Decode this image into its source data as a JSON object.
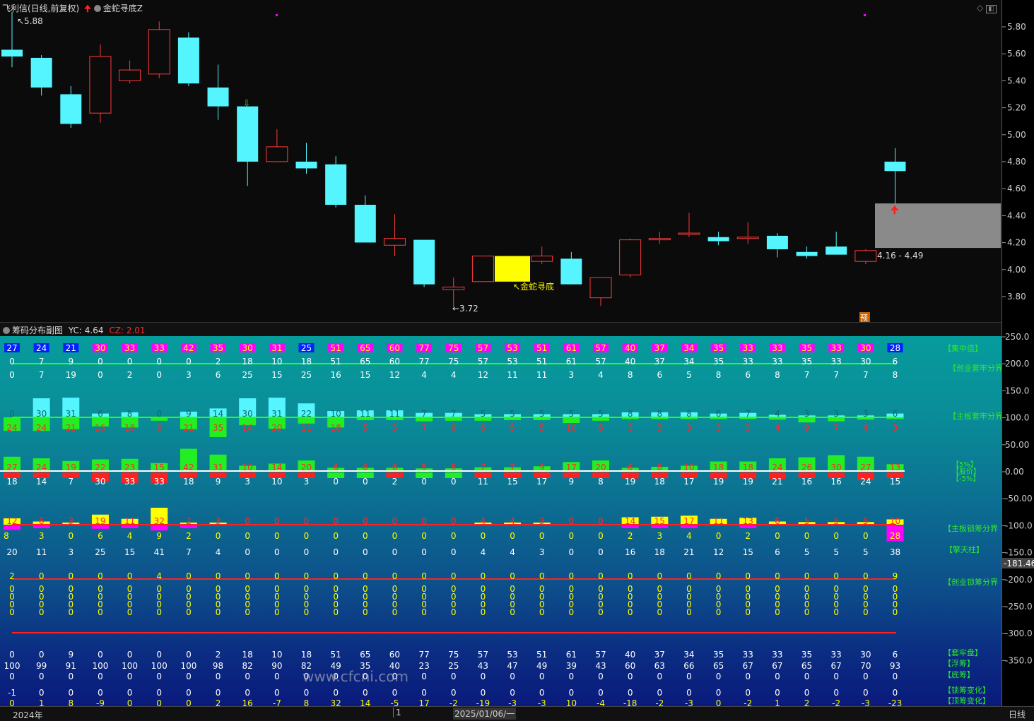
{
  "header": {
    "stock": "飞利信(日线,前复权)",
    "formula": "金蛇寻底Z",
    "sub_title": "筹码分布副图",
    "yc_label": "YC:",
    "yc_value": "4.64",
    "cz_label": "CZ:",
    "cz_value": "2.01"
  },
  "price_axis": [
    "5.80",
    "5.60",
    "5.40",
    "5.20",
    "5.00",
    "4.80",
    "4.60",
    "4.40",
    "4.20",
    "4.00",
    "3.80"
  ],
  "sub_axis": [
    "250.0",
    "200.0",
    "150.0",
    "100.0",
    "50.00",
    "0.00",
    "-50.00",
    "-100.0",
    "-150.0",
    "-200.0",
    "-250.0",
    "-300.0",
    "-350.0"
  ],
  "cursor_value": "-181.46",
  "annotations": {
    "high": "5.88",
    "low": "3.72",
    "range": "4.16 - 4.49",
    "signal_text": "金蛇寻底",
    "pre_badge": "预"
  },
  "colors": {
    "up": "#ff3b3b",
    "down": "#54f5ff",
    "yellow": "#ffff00",
    "green": "#22ee22",
    "magenta": "#ff00ff",
    "blue": "#0020ff"
  },
  "candles": [
    {
      "o": 5.58,
      "h": 5.91,
      "l": 5.5,
      "c": 5.63,
      "up": false
    },
    {
      "o": 5.57,
      "h": 5.59,
      "l": 5.29,
      "c": 5.35,
      "up": false
    },
    {
      "o": 5.3,
      "h": 5.36,
      "l": 5.05,
      "c": 5.08,
      "up": false
    },
    {
      "o": 5.16,
      "h": 5.67,
      "l": 5.09,
      "c": 5.58,
      "up": true
    },
    {
      "o": 5.4,
      "h": 5.55,
      "l": 5.38,
      "c": 5.48,
      "up": true
    },
    {
      "o": 5.45,
      "h": 5.84,
      "l": 5.42,
      "c": 5.78,
      "up": true
    },
    {
      "o": 5.72,
      "h": 5.76,
      "l": 5.36,
      "c": 5.38,
      "up": false
    },
    {
      "o": 5.35,
      "h": 5.52,
      "l": 5.11,
      "c": 5.21,
      "up": false
    },
    {
      "o": 5.21,
      "h": 5.21,
      "l": 4.62,
      "c": 4.8,
      "up": false
    },
    {
      "o": 4.8,
      "h": 5.04,
      "l": 4.8,
      "c": 4.91,
      "up": true
    },
    {
      "o": 4.8,
      "h": 4.94,
      "l": 4.71,
      "c": 4.75,
      "up": false
    },
    {
      "o": 4.78,
      "h": 4.84,
      "l": 4.46,
      "c": 4.48,
      "up": false
    },
    {
      "o": 4.48,
      "h": 4.55,
      "l": 4.2,
      "c": 4.2,
      "up": false
    },
    {
      "o": 4.18,
      "h": 4.41,
      "l": 4.1,
      "c": 4.23,
      "up": true
    },
    {
      "o": 4.22,
      "h": 4.22,
      "l": 3.87,
      "c": 3.89,
      "up": false
    },
    {
      "o": 3.85,
      "h": 3.94,
      "l": 3.72,
      "c": 3.87,
      "up": true
    },
    {
      "o": 3.91,
      "h": 4.1,
      "l": 3.91,
      "c": 4.1,
      "up": true
    },
    {
      "o": 4.1,
      "h": 4.1,
      "l": 3.91,
      "c": 3.92,
      "up": false
    },
    {
      "o": 4.06,
      "h": 4.17,
      "l": 4.04,
      "c": 4.1,
      "up": true
    },
    {
      "o": 4.08,
      "h": 4.13,
      "l": 3.89,
      "c": 3.89,
      "up": false
    },
    {
      "o": 3.79,
      "h": 3.94,
      "l": 3.73,
      "c": 3.94,
      "up": true
    },
    {
      "o": 3.96,
      "h": 4.23,
      "l": 3.94,
      "c": 4.22,
      "up": true
    },
    {
      "o": 4.22,
      "h": 4.28,
      "l": 4.19,
      "c": 4.23,
      "up": true
    },
    {
      "o": 4.26,
      "h": 4.42,
      "l": 4.24,
      "c": 4.27,
      "up": true
    },
    {
      "o": 4.24,
      "h": 4.28,
      "l": 4.18,
      "c": 4.21,
      "up": false
    },
    {
      "o": 4.23,
      "h": 4.35,
      "l": 4.19,
      "c": 4.24,
      "up": true
    },
    {
      "o": 4.25,
      "h": 4.27,
      "l": 4.09,
      "c": 4.15,
      "up": false
    },
    {
      "o": 4.13,
      "h": 4.17,
      "l": 4.08,
      "c": 4.1,
      "up": false
    },
    {
      "o": 4.17,
      "h": 4.28,
      "l": 4.11,
      "c": 4.11,
      "up": false
    },
    {
      "o": 4.06,
      "h": 4.15,
      "l": 4.04,
      "c": 4.14,
      "up": true
    },
    {
      "o": 4.8,
      "h": 4.9,
      "l": 4.45,
      "c": 4.73,
      "up": false
    }
  ],
  "rows": {
    "r1_top": [
      "27",
      "24",
      "21",
      "30",
      "33",
      "33",
      "42",
      "35",
      "30",
      "31",
      "25",
      "51",
      "65",
      "60",
      "77",
      "75",
      "57",
      "53",
      "51",
      "61",
      "57",
      "40",
      "37",
      "34",
      "35",
      "33",
      "33",
      "35",
      "33",
      "30",
      "28"
    ],
    "r1_mid": [
      "0",
      "7",
      "9",
      "0",
      "0",
      "0",
      "0",
      "2",
      "18",
      "10",
      "18",
      "51",
      "65",
      "60",
      "77",
      "75",
      "57",
      "53",
      "51",
      "61",
      "57",
      "40",
      "37",
      "34",
      "35",
      "33",
      "33",
      "35",
      "33",
      "30",
      "6"
    ],
    "r1_bot": [
      "0",
      "7",
      "19",
      "0",
      "2",
      "0",
      "3",
      "6",
      "25",
      "15",
      "25",
      "16",
      "15",
      "12",
      "4",
      "4",
      "12",
      "11",
      "11",
      "3",
      "4",
      "8",
      "6",
      "5",
      "8",
      "6",
      "8",
      "7",
      "7",
      "7",
      "8"
    ],
    "r2_up": [
      "0",
      "30",
      "31",
      "6",
      "8",
      "0",
      "9",
      "14",
      "30",
      "31",
      "22",
      "10",
      "11",
      "11",
      "7",
      "7",
      "5",
      "5",
      "5",
      "5",
      "5",
      "8",
      "8",
      "8",
      "6",
      "7",
      "4",
      "3",
      "3",
      "3",
      "6"
    ],
    "r2_dn": [
      "24",
      "24",
      "21",
      "16",
      "18",
      "6",
      "21",
      "35",
      "14",
      "20",
      "11",
      "18",
      "5",
      "5",
      "7",
      "6",
      "6",
      "5",
      "5",
      "10",
      "6",
      "3",
      "3",
      "3",
      "3",
      "3",
      "4",
      "9",
      "7",
      "4",
      "3"
    ],
    "r3_up": [
      "27",
      "24",
      "19",
      "22",
      "23",
      "15",
      "42",
      "31",
      "10",
      "14",
      "20",
      "6",
      "6",
      "6",
      "5",
      "5",
      "7",
      "7",
      "9",
      "17",
      "20",
      "6",
      "8",
      "10",
      "18",
      "18",
      "24",
      "26",
      "30",
      "27",
      "13"
    ],
    "r3_dn": [
      "18",
      "14",
      "7",
      "30",
      "33",
      "33",
      "18",
      "9",
      "3",
      "10",
      "3",
      "0",
      "0",
      "2",
      "0",
      "0",
      "11",
      "15",
      "17",
      "9",
      "8",
      "19",
      "18",
      "17",
      "19",
      "19",
      "21",
      "16",
      "16",
      "24",
      "15"
    ],
    "r4_top": [
      "12",
      "6",
      "3",
      "19",
      "11",
      "32",
      "2",
      "3",
      "0",
      "0",
      "0",
      "0",
      "0",
      "0",
      "0",
      "0",
      "4",
      "4",
      "3",
      "0",
      "0",
      "14",
      "15",
      "17",
      "11",
      "13",
      "6",
      "5",
      "5",
      "5",
      "10"
    ],
    "r4_bot": [
      "8",
      "3",
      "0",
      "6",
      "4",
      "9",
      "2",
      "0",
      "0",
      "0",
      "0",
      "0",
      "0",
      "0",
      "0",
      "0",
      "0",
      "0",
      "0",
      "0",
      "0",
      "2",
      "3",
      "4",
      "0",
      "2",
      "0",
      "0",
      "0",
      "0",
      "28"
    ],
    "r5": [
      "20",
      "11",
      "3",
      "25",
      "15",
      "41",
      "7",
      "4",
      "0",
      "0",
      "0",
      "0",
      "0",
      "0",
      "0",
      "0",
      "4",
      "4",
      "3",
      "0",
      "0",
      "16",
      "18",
      "21",
      "12",
      "15",
      "6",
      "5",
      "5",
      "5",
      "38"
    ],
    "r6": [
      "2",
      "0",
      "0",
      "0",
      "0",
      "4",
      "0",
      "0",
      "0",
      "0",
      "0",
      "0",
      "0",
      "0",
      "0",
      "0",
      "0",
      "0",
      "0",
      "0",
      "0",
      "0",
      "0",
      "0",
      "0",
      "0",
      "0",
      "0",
      "0",
      "0",
      "9"
    ],
    "r7": [
      "0",
      "0",
      "9",
      "0",
      "0",
      "0",
      "0",
      "2",
      "18",
      "10",
      "18",
      "51",
      "65",
      "60",
      "77",
      "75",
      "57",
      "53",
      "51",
      "61",
      "57",
      "40",
      "37",
      "34",
      "35",
      "33",
      "33",
      "35",
      "33",
      "30",
      "6"
    ],
    "r8": [
      "100",
      "99",
      "91",
      "100",
      "100",
      "100",
      "100",
      "98",
      "82",
      "90",
      "82",
      "49",
      "35",
      "40",
      "23",
      "25",
      "43",
      "47",
      "49",
      "39",
      "43",
      "60",
      "63",
      "66",
      "65",
      "67",
      "67",
      "65",
      "67",
      "70",
      "93"
    ],
    "r9": [
      "0",
      "0",
      "0",
      "0",
      "0",
      "0",
      "0",
      "0",
      "0",
      "0",
      "0",
      "0",
      "0",
      "0",
      "0",
      "0",
      "0",
      "0",
      "0",
      "0",
      "0",
      "0",
      "0",
      "0",
      "0",
      "0",
      "0",
      "0",
      "0",
      "0",
      "0"
    ],
    "r10": [
      "-1",
      "0",
      "0",
      "0",
      "0",
      "0",
      "0",
      "0",
      "0",
      "0",
      "0",
      "0",
      "0",
      "0",
      "0",
      "0",
      "0",
      "0",
      "0",
      "0",
      "0",
      "0",
      "0",
      "0",
      "0",
      "0",
      "0",
      "0",
      "0",
      "0",
      "0"
    ],
    "r11": [
      "0",
      "1",
      "8",
      "-9",
      "0",
      "0",
      "0",
      "2",
      "16",
      "-7",
      "8",
      "32",
      "14",
      "-5",
      "17",
      "-2",
      "-19",
      "-3",
      "-3",
      "10",
      "-4",
      "-18",
      "-2",
      "-3",
      "0",
      "-2",
      "1",
      "2",
      "-2",
      "-3",
      "-23"
    ]
  },
  "right_labels": {
    "l1": "【集中值】",
    "l2": "【创业套牢分界",
    "l3": "【主板套牢分界",
    "l4a": "【5%】",
    "l4b": "【股价】",
    "l4c": "【-5%】",
    "l5": "【主板锁筹分界",
    "l6": "【擎天柱】",
    "l7": "【创业锁筹分界",
    "l8": "【套牢盘】",
    "l9": "【浮筹】",
    "l10": "【底筹】",
    "l11": "【锁筹变化】",
    "l12": "【顶筹变化】"
  },
  "bottom": {
    "year": "2024年",
    "page": "1",
    "date": "2025/01/06/一",
    "period": "日线"
  },
  "watermark": "www.cfcni.com"
}
